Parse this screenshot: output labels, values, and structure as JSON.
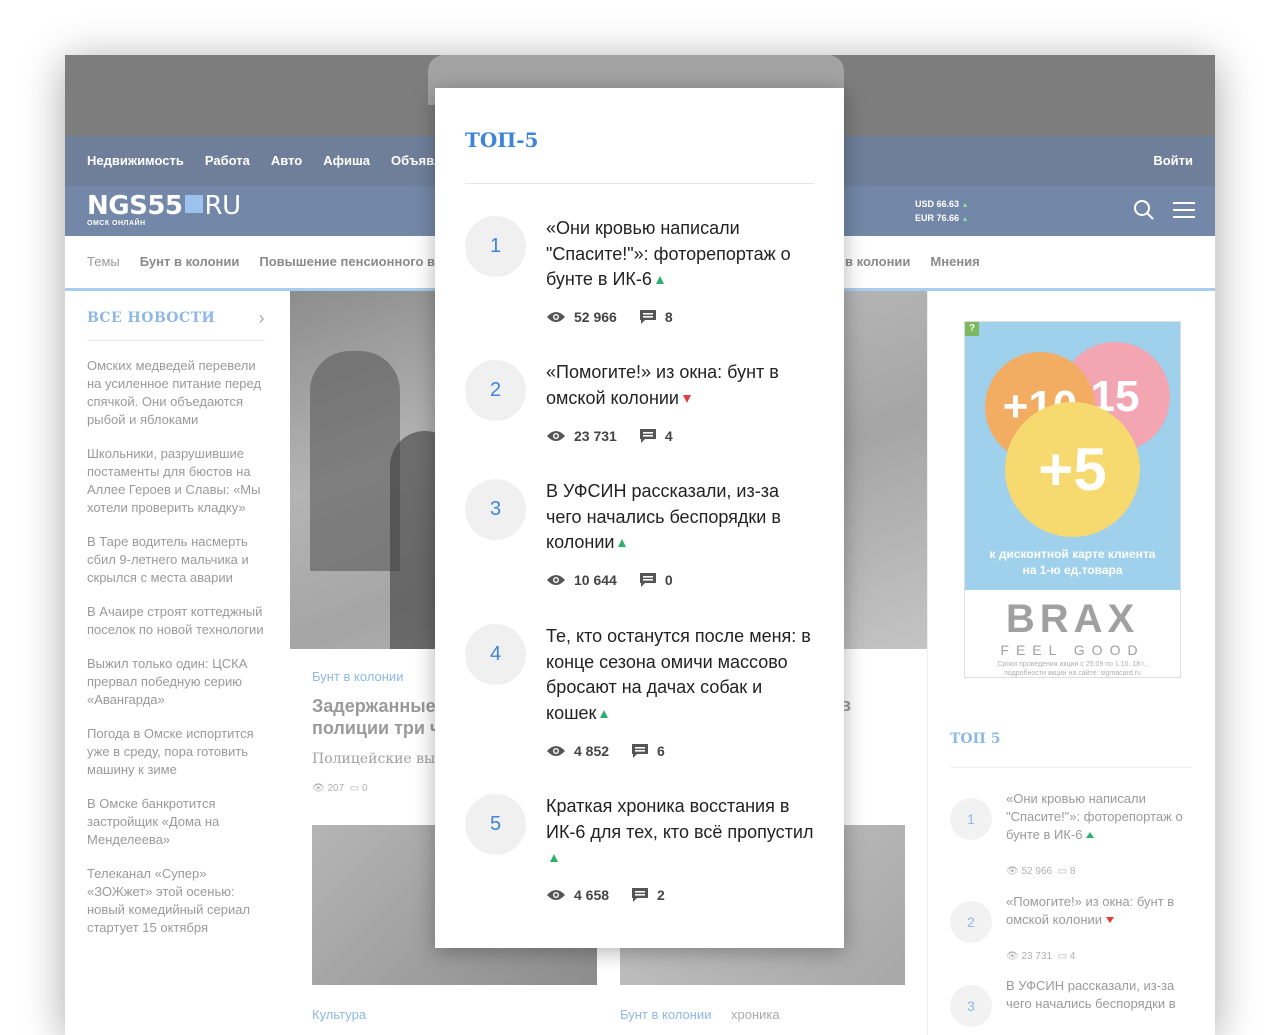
{
  "nav": {
    "links": [
      "Недвижимость",
      "Работа",
      "Авто",
      "Афиша",
      "Объявл"
    ],
    "login": "Войти"
  },
  "header": {
    "logo_main": "NGS55",
    "logo_ru": "RU",
    "logo_sub": "ОМСК ОНЛАЙН",
    "usd": "USD 66.63",
    "eur": "EUR 76.66"
  },
  "topics": {
    "left": [
      "Темы",
      "Бунт в колонии",
      "Повышение пенсионного в"
    ],
    "right": [
      "в колонии",
      "Мнения"
    ]
  },
  "sidebar": {
    "title": "ВСЕ НОВОСТИ",
    "items": [
      "Омских медведей перевели на усиленное питание перед спячкой. Они объедаются рыбой и яблоками",
      "Школьники, разрушившие постаменты для бюстов на Аллее Героев и Славы: «Мы хотели проверить кладку»",
      "В Таре водитель насмерть сбил 9-летнего мальчика и скрылся с места аварии",
      "В Ачаире строят коттеджный поселок по новой технологии",
      "Выжил только один: ЦСКА прервал победную серию «Авангарда»",
      "Погода в Омске испортится уже в среду, пора готовить машину к зиме",
      "В Омске банкротится застройщик «Дома на Менделеева»",
      "Телеканал «Супер» «ЗОЖжет» этой осенью: новый комедийный сериал стартует 15 октября"
    ]
  },
  "main": {
    "card_category": "Бунт в колонии",
    "card_title": "Задержанные полиции три ч",
    "card_lead": "Полицейские вы",
    "card_views": "207",
    "card_comments": "0",
    "card_title_right": "в",
    "cat_a": "Культура",
    "cat_b": "Бунт в колонии",
    "cat_c": "хроника"
  },
  "ad": {
    "q": "?",
    "c1": "+10",
    "c2": "15",
    "c3": "+5",
    "caption_1": "к дисконтной карте клиента",
    "caption_2": "на 1-ю ед.товара",
    "brand": "BRAX",
    "feel": "FEEL GOOD",
    "terms_1": "Сроки проведения акции с 25.09 по 1.10. 18 г.,",
    "terms_2": "подробности акции на сайте: sigmacard.ru"
  },
  "right_top": {
    "title": "ТОП 5",
    "items": [
      {
        "num": "1",
        "title": "«Они кровью написали \"Спасите!\"»: фоторепортаж о бунте в ИК-6",
        "views": "52 966",
        "comments": "8",
        "trend": "up"
      },
      {
        "num": "2",
        "title": "«Помогите!» из окна: бунт в омской колонии",
        "views": "23 731",
        "comments": "4",
        "trend": "down"
      },
      {
        "num": "3",
        "title": "В УФСИН рассказали, из-за чего начались беспорядки в",
        "views": "",
        "comments": "",
        "trend": ""
      }
    ]
  },
  "modal": {
    "title": "ТОП-5",
    "items": [
      {
        "num": "1",
        "title": "«Они кровью написали \"Спасите!\"»: фоторепортаж о бунте в ИК-6",
        "views": "52 966",
        "comments": "8",
        "trend": "up"
      },
      {
        "num": "2",
        "title": "«Помогите!» из окна: бунт в омской колонии",
        "views": "23 731",
        "comments": "4",
        "trend": "down"
      },
      {
        "num": "3",
        "title": "В УФСИН рассказали, из-за чего начались беспорядки в колонии",
        "views": "10 644",
        "comments": "0",
        "trend": "up"
      },
      {
        "num": "4",
        "title": "Те, кто останутся после меня: в конце сезона омичи массово бросают на дачах собак и кошек",
        "views": "4 852",
        "comments": "6",
        "trend": "up"
      },
      {
        "num": "5",
        "title": "Краткая хроника восстания в ИК-6 для тех, кто всё пропустил",
        "views": "4 658",
        "comments": "2",
        "trend": "up"
      }
    ]
  },
  "colors": {
    "accent": "#3d84d8",
    "trend_up": "#2fb06a",
    "trend_down": "#e43d3d",
    "nav_bg": "#6f7f9a",
    "header_bg": "#7388a8"
  }
}
